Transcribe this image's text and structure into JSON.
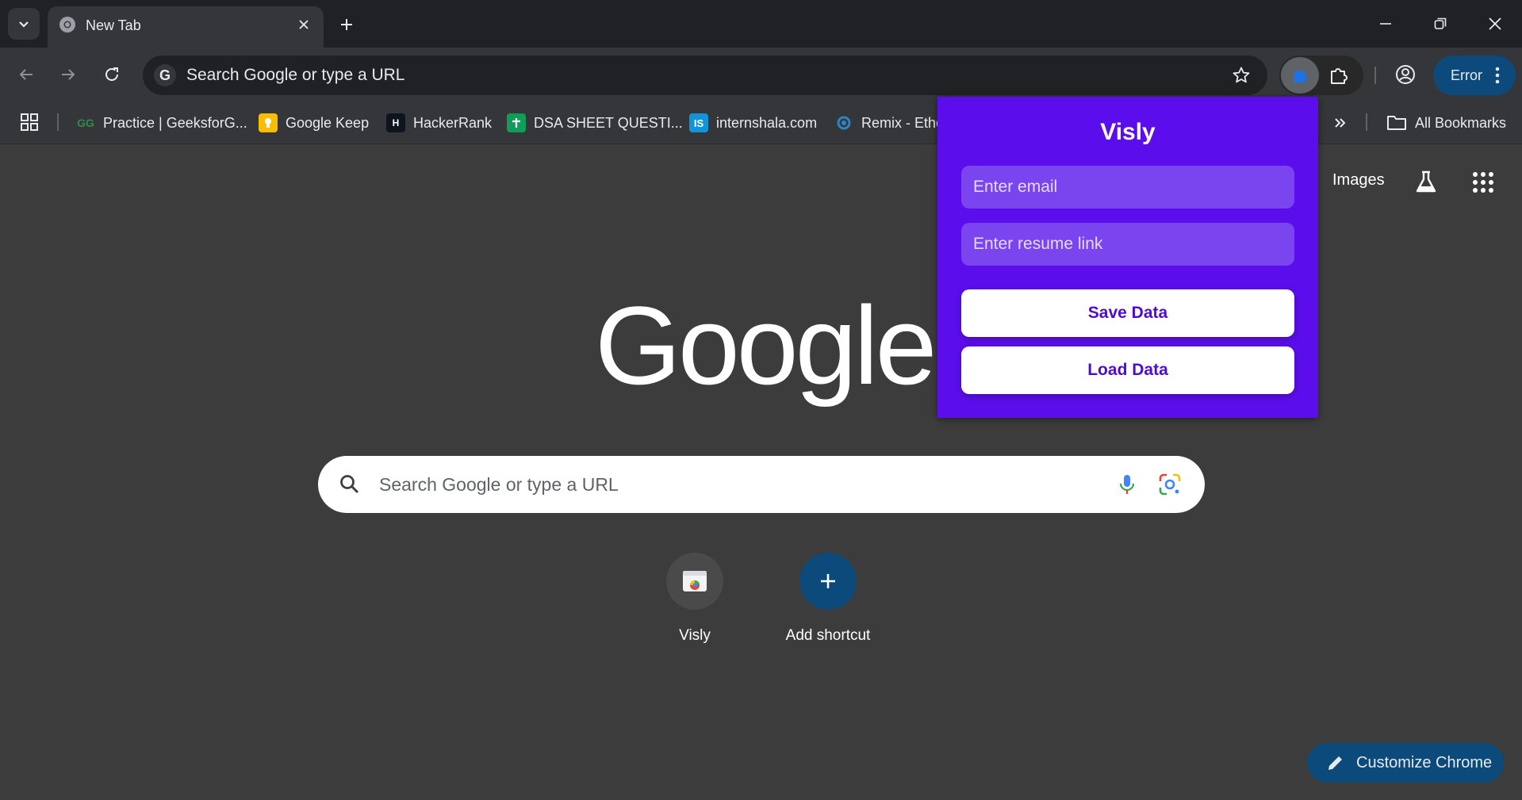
{
  "colors": {
    "popup_bg": "#5b0eeb",
    "popup_input_bg": "#7a44ef",
    "button_text": "#4d0ccf",
    "accent_pill": "#0b4a7a"
  },
  "tab": {
    "title": "New Tab",
    "icon": "chrome-icon"
  },
  "omnibox": {
    "text": "Search Google or type a URL"
  },
  "toolbar": {
    "error_label": "Error"
  },
  "bookmarks": {
    "items": [
      {
        "label": "Practice | GeeksforG...",
        "icon": "geeksforgeeks-icon"
      },
      {
        "label": "Google Keep",
        "icon": "google-keep-icon"
      },
      {
        "label": "HackerRank",
        "icon": "hackerrank-icon"
      },
      {
        "label": "DSA SHEET QUESTI...",
        "icon": "google-sheets-icon"
      },
      {
        "label": "internshala.com",
        "icon": "internshala-icon"
      },
      {
        "label": "Remix - Ethe",
        "icon": "remix-icon"
      }
    ],
    "all_label": "All Bookmarks"
  },
  "ntp": {
    "images_link": "Images",
    "logo": "Google",
    "search_placeholder": "Search Google or type a URL",
    "shortcuts": [
      {
        "label": "Visly"
      },
      {
        "label": "Add shortcut"
      }
    ],
    "customize_label": "Customize Chrome"
  },
  "popup": {
    "title": "Visly",
    "email_placeholder": "Enter email",
    "resume_placeholder": "Enter resume link",
    "save_label": "Save Data",
    "load_label": "Load Data"
  }
}
